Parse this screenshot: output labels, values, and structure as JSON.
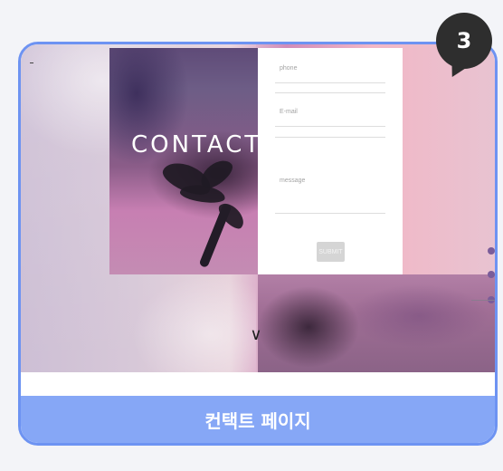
{
  "badge": {
    "number": "3"
  },
  "preview": {
    "hero_title": "CONTACT",
    "form": {
      "phone_label": "phone",
      "email_label": "E-mail",
      "message_label": "message",
      "submit_label": "SUBMIT"
    },
    "scroll_arrow": "∨"
  },
  "footer": {
    "label": "컨택트 페이지"
  },
  "colors": {
    "accent": "#6d93f2",
    "label_bar": "#86a7f6",
    "badge": "#2e2e2e"
  }
}
